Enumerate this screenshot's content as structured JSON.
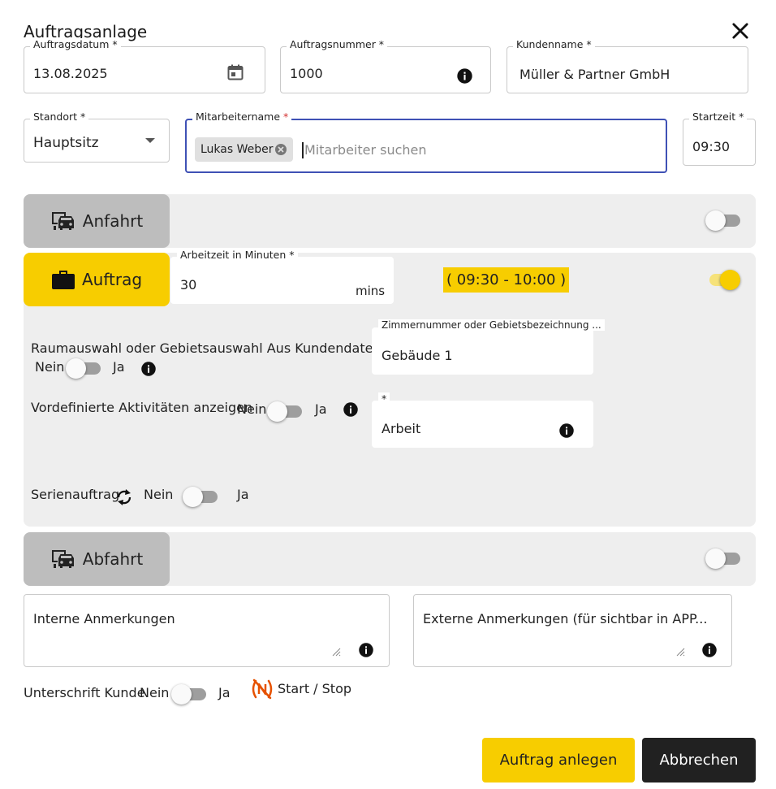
{
  "dialog": {
    "title": "Auftragsanlage"
  },
  "fields": {
    "order_date": {
      "label": "Auftragsdatum *",
      "value": "13.08.2025"
    },
    "order_number": {
      "label": "Auftragsnummer *",
      "value": "1000"
    },
    "customer_name": {
      "label": "Kundenname *",
      "value": "Müller & Partner GmbH"
    },
    "location": {
      "label": "Standort *",
      "value": "Hauptsitz"
    },
    "employee": {
      "label": "Mitarbeitername",
      "required_mark": "*",
      "chip": "Lukas Weber",
      "placeholder": "Mitarbeiter suchen"
    },
    "start_time": {
      "label": "Startzeit *",
      "value": "09:30"
    }
  },
  "sections": {
    "arrival": {
      "label": "Anfahrt",
      "toggle_on": false
    },
    "order": {
      "label": "Auftrag",
      "toggle_on": true,
      "work_time_label": "Arbeitzeit in Minuten *",
      "work_time_value": "30",
      "work_time_unit": "mins",
      "time_range": "( 09:30 - 10:00 )",
      "room_selection_label": "Raumauswahl oder Gebietsauswahl Aus Kundendaten",
      "room_number_label": "Zimmernummer oder Gebietsbezeichnung ...",
      "room_number_value": "Gebäude 1",
      "predefined_label": "Vordefinierte Aktivitäten anzeigen",
      "activity_label": "*",
      "activity_value": "Arbeit",
      "series_label": "Serienauftrag"
    },
    "departure": {
      "label": "Abfahrt",
      "toggle_on": false
    }
  },
  "toggle_text": {
    "no": "Nein",
    "yes": "Ja"
  },
  "notes": {
    "internal_placeholder": "Interne Anmerkungen",
    "external_placeholder": "Externe Anmerkungen (für sichtbar in APP..."
  },
  "signature": {
    "label": "Unterschrift Kunde"
  },
  "start_stop": {
    "label": "Start / Stop"
  },
  "buttons": {
    "create": "Auftrag anlegen",
    "cancel": "Abbrechen"
  },
  "colors": {
    "accent": "#f7cd00",
    "focus": "#3f51b5",
    "dark_button": "#212121",
    "section_bg": "#eeeeee",
    "chip_gray": "#bdbdbd",
    "nfc": "#e65100"
  }
}
